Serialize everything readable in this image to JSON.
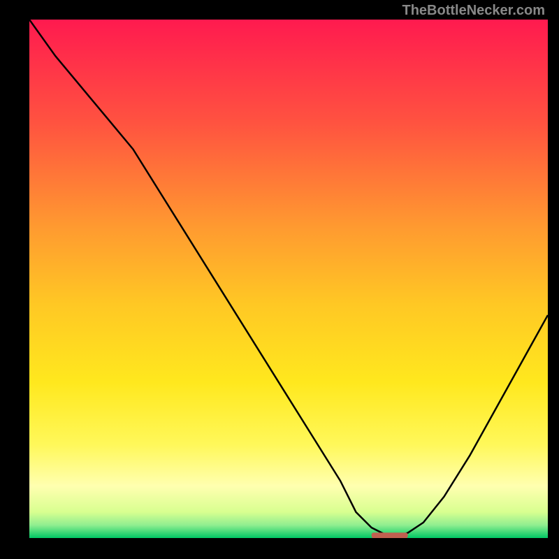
{
  "watermark": "TheBottleNecker.com",
  "chart_data": {
    "type": "line",
    "title": "",
    "xlabel": "",
    "ylabel": "",
    "xlim": [
      0,
      100
    ],
    "ylim": [
      0,
      100
    ],
    "series": [
      {
        "name": "bottleneck-curve",
        "x": [
          0,
          5,
          10,
          15,
          20,
          25,
          30,
          35,
          40,
          45,
          50,
          55,
          60,
          63,
          66,
          70,
          73,
          76,
          80,
          85,
          90,
          95,
          100
        ],
        "y": [
          100,
          93,
          87,
          81,
          75,
          67,
          59,
          51,
          43,
          35,
          27,
          19,
          11,
          5,
          2,
          0,
          1,
          3,
          8,
          16,
          25,
          34,
          43
        ]
      }
    ],
    "marker": {
      "x_range": [
        66,
        73
      ],
      "y": 0.5,
      "color": "#c06050"
    },
    "gradient_stops": [
      {
        "offset": 0.0,
        "color": "#ff1a4f"
      },
      {
        "offset": 0.2,
        "color": "#ff5340"
      },
      {
        "offset": 0.4,
        "color": "#ff9a30"
      },
      {
        "offset": 0.55,
        "color": "#ffc824"
      },
      {
        "offset": 0.7,
        "color": "#ffe81e"
      },
      {
        "offset": 0.82,
        "color": "#fff85a"
      },
      {
        "offset": 0.9,
        "color": "#ffffb0"
      },
      {
        "offset": 0.95,
        "color": "#d8ff90"
      },
      {
        "offset": 0.975,
        "color": "#90ee90"
      },
      {
        "offset": 1.0,
        "color": "#00c864"
      }
    ]
  }
}
